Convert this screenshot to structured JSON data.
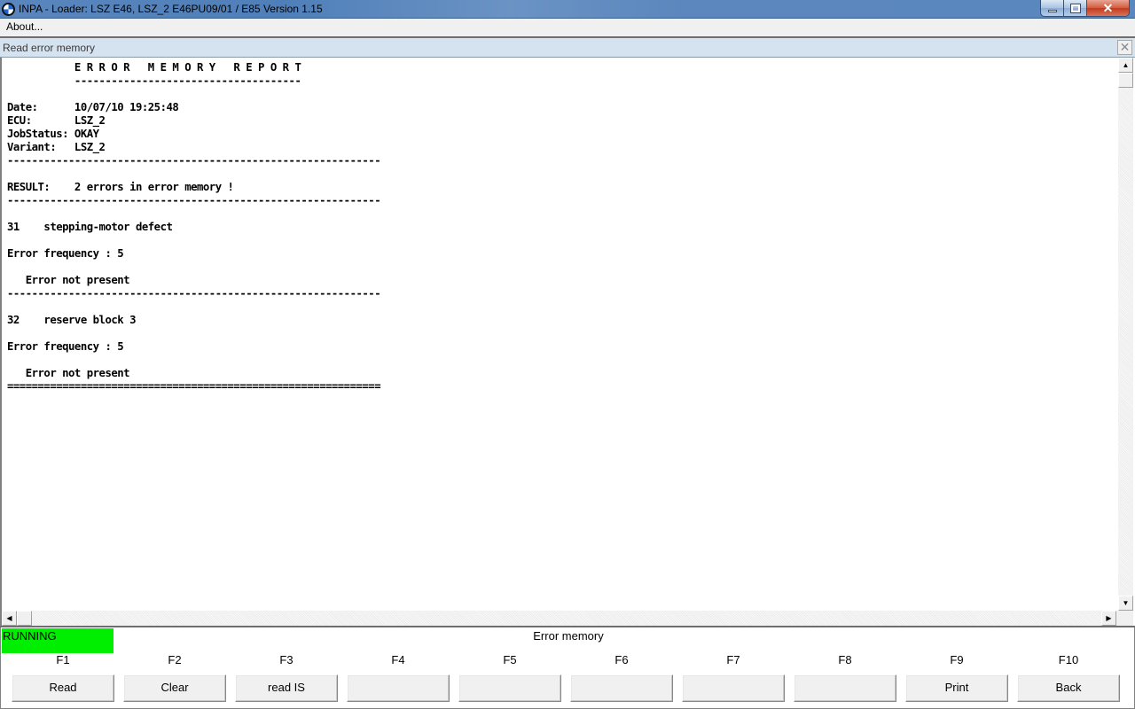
{
  "window": {
    "title": "INPA - Loader:  LSZ E46, LSZ_2 E46PU09/01 / E85 Version 1.15",
    "controls": {
      "minimize": "minimize",
      "maximize": "maximize",
      "close": "✕"
    }
  },
  "menu": {
    "items": [
      {
        "label": "About..."
      }
    ]
  },
  "child_window": {
    "title": "Read error memory",
    "close": "✕"
  },
  "report": {
    "lines": [
      "           E R R O R   M E M O R Y   R E P O R T",
      "           -------------------------------------",
      "",
      "Date:      10/07/10 19:25:48",
      "ECU:       LSZ_2",
      "JobStatus: OKAY",
      "Variant:   LSZ_2",
      "-------------------------------------------------------------",
      "",
      "RESULT:    2 errors in error memory !",
      "-------------------------------------------------------------",
      "",
      "31    stepping-motor defect",
      "",
      "Error frequency : 5",
      "",
      "   Error not present",
      "-------------------------------------------------------------",
      "",
      "32    reserve block 3",
      "",
      "Error frequency : 5",
      "",
      "   Error not present",
      "============================================================="
    ]
  },
  "scrollbars": {
    "up": "▲",
    "down": "▼",
    "left": "◀",
    "right": "▶"
  },
  "status": {
    "state": "RUNNING",
    "state_color": "#00ee00",
    "text": "Error memory"
  },
  "fkeys": [
    {
      "key": "F1",
      "label": "Read"
    },
    {
      "key": "F2",
      "label": "Clear"
    },
    {
      "key": "F3",
      "label": "read IS"
    },
    {
      "key": "F4",
      "label": ""
    },
    {
      "key": "F5",
      "label": ""
    },
    {
      "key": "F6",
      "label": ""
    },
    {
      "key": "F7",
      "label": ""
    },
    {
      "key": "F8",
      "label": ""
    },
    {
      "key": "F9",
      "label": "Print"
    },
    {
      "key": "F10",
      "label": "Back"
    }
  ]
}
